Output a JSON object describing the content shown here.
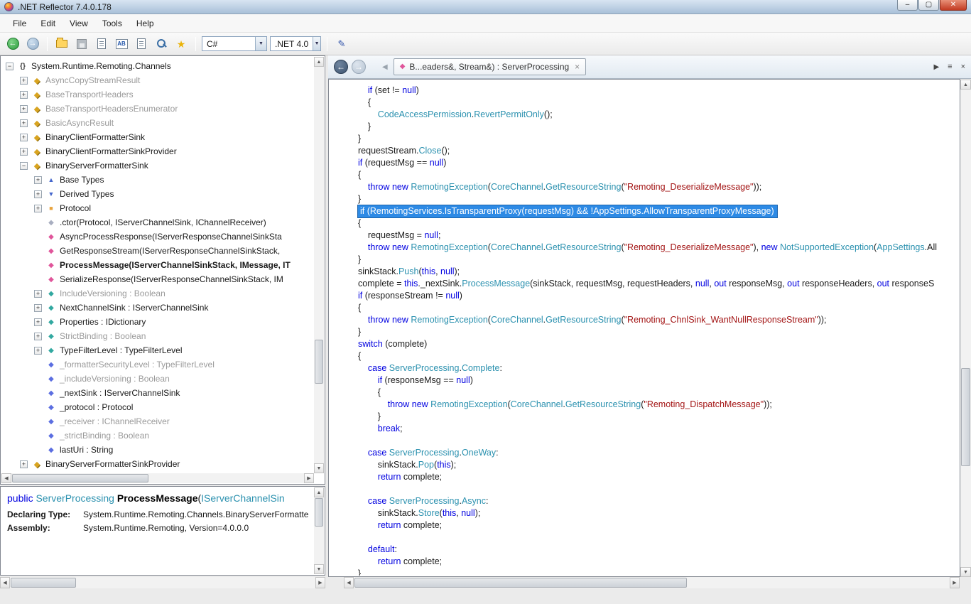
{
  "window": {
    "title": ".NET Reflector 7.4.0.178"
  },
  "menu": {
    "items": [
      "File",
      "Edit",
      "View",
      "Tools",
      "Help"
    ]
  },
  "toolbar": {
    "language_value": "C#",
    "framework_value": ".NET 4.0"
  },
  "docktab": {
    "title": "B...eaders&, Stream&) : ServerProcessing"
  },
  "tree": {
    "rows": [
      {
        "depth": 0,
        "expander": "minus",
        "icon": "namespace",
        "label": "System.Runtime.Remoting.Channels",
        "dim": false
      },
      {
        "depth": 1,
        "expander": "plus",
        "icon": "class",
        "label": "AsyncCopyStreamResult",
        "dim": true
      },
      {
        "depth": 1,
        "expander": "plus",
        "icon": "class",
        "label": "BaseTransportHeaders",
        "dim": true
      },
      {
        "depth": 1,
        "expander": "plus",
        "icon": "class",
        "label": "BaseTransportHeadersEnumerator",
        "dim": true
      },
      {
        "depth": 1,
        "expander": "plus",
        "icon": "class",
        "label": "BasicAsyncResult",
        "dim": true
      },
      {
        "depth": 1,
        "expander": "plus",
        "icon": "class",
        "label": "BinaryClientFormatterSink",
        "dim": false
      },
      {
        "depth": 1,
        "expander": "plus",
        "icon": "class",
        "label": "BinaryClientFormatterSinkProvider",
        "dim": false
      },
      {
        "depth": 1,
        "expander": "minus",
        "icon": "class",
        "label": "BinaryServerFormatterSink",
        "dim": false
      },
      {
        "depth": 2,
        "expander": "plus",
        "icon": "base-types",
        "label": "Base Types",
        "dim": false
      },
      {
        "depth": 2,
        "expander": "plus",
        "icon": "derived-types",
        "label": "Derived Types",
        "dim": false
      },
      {
        "depth": 2,
        "expander": "plus",
        "icon": "enum",
        "label": "Protocol",
        "dim": false
      },
      {
        "depth": 2,
        "expander": "none",
        "icon": "ctor",
        "label": ".ctor(Protocol, IServerChannelSink, IChannelReceiver)",
        "dim": false
      },
      {
        "depth": 2,
        "expander": "none",
        "icon": "method",
        "label": "AsyncProcessResponse(IServerResponseChannelSinkSta",
        "dim": false
      },
      {
        "depth": 2,
        "expander": "none",
        "icon": "method",
        "label": "GetResponseStream(IServerResponseChannelSinkStack,",
        "dim": false
      },
      {
        "depth": 2,
        "expander": "none",
        "icon": "method",
        "label": "ProcessMessage(IServerChannelSinkStack, IMessage, IT",
        "dim": false,
        "bold": true
      },
      {
        "depth": 2,
        "expander": "none",
        "icon": "method",
        "label": "SerializeResponse(IServerResponseChannelSinkStack, IM",
        "dim": false
      },
      {
        "depth": 2,
        "expander": "plus",
        "icon": "property",
        "label": "IncludeVersioning : Boolean",
        "dim": true
      },
      {
        "depth": 2,
        "expander": "plus",
        "icon": "property",
        "label": "NextChannelSink : IServerChannelSink",
        "dim": false
      },
      {
        "depth": 2,
        "expander": "plus",
        "icon": "property",
        "label": "Properties : IDictionary",
        "dim": false
      },
      {
        "depth": 2,
        "expander": "plus",
        "icon": "property",
        "label": "StrictBinding : Boolean",
        "dim": true
      },
      {
        "depth": 2,
        "expander": "plus",
        "icon": "property",
        "label": "TypeFilterLevel : TypeFilterLevel",
        "dim": false
      },
      {
        "depth": 2,
        "expander": "none",
        "icon": "field",
        "label": "_formatterSecurityLevel : TypeFilterLevel",
        "dim": true
      },
      {
        "depth": 2,
        "expander": "none",
        "icon": "field",
        "label": "_includeVersioning : Boolean",
        "dim": true
      },
      {
        "depth": 2,
        "expander": "none",
        "icon": "field",
        "label": "_nextSink : IServerChannelSink",
        "dim": false
      },
      {
        "depth": 2,
        "expander": "none",
        "icon": "field",
        "label": "_protocol : Protocol",
        "dim": false
      },
      {
        "depth": 2,
        "expander": "none",
        "icon": "field",
        "label": "_receiver : IChannelReceiver",
        "dim": true
      },
      {
        "depth": 2,
        "expander": "none",
        "icon": "field",
        "label": "_strictBinding : Boolean",
        "dim": true
      },
      {
        "depth": 2,
        "expander": "none",
        "icon": "field",
        "label": "lastUri : String",
        "dim": false
      },
      {
        "depth": 1,
        "expander": "plus",
        "icon": "class",
        "label": "BinaryServerFormatterSinkProvider",
        "dim": false
      }
    ]
  },
  "code": {
    "lines": [
      {
        "i": 1,
        "tok": [
          [
            "k",
            "if"
          ],
          [
            "p",
            " (set != "
          ],
          [
            "k",
            "null"
          ],
          [
            "p",
            ")"
          ]
        ]
      },
      {
        "i": 1,
        "tok": [
          [
            "p",
            "{"
          ]
        ]
      },
      {
        "i": 2,
        "tok": [
          [
            "t",
            "CodeAccessPermission"
          ],
          [
            "p",
            "."
          ],
          [
            "t",
            "RevertPermitOnly"
          ],
          [
            "p",
            "();"
          ]
        ]
      },
      {
        "i": 1,
        "tok": [
          [
            "p",
            "}"
          ]
        ]
      },
      {
        "i": 0,
        "tok": [
          [
            "p",
            "}"
          ]
        ]
      },
      {
        "i": 0,
        "tok": [
          [
            "p",
            "requestStream."
          ],
          [
            "t",
            "Close"
          ],
          [
            "p",
            "();"
          ]
        ]
      },
      {
        "i": 0,
        "tok": [
          [
            "k",
            "if"
          ],
          [
            "p",
            " (requestMsg == "
          ],
          [
            "k",
            "null"
          ],
          [
            "p",
            ")"
          ]
        ]
      },
      {
        "i": 0,
        "tok": [
          [
            "p",
            "{"
          ]
        ]
      },
      {
        "i": 1,
        "tok": [
          [
            "k",
            "throw"
          ],
          [
            "p",
            " "
          ],
          [
            "k",
            "new"
          ],
          [
            "p",
            " "
          ],
          [
            "t",
            "RemotingException"
          ],
          [
            "p",
            "("
          ],
          [
            "t",
            "CoreChannel"
          ],
          [
            "p",
            "."
          ],
          [
            "t",
            "GetResourceString"
          ],
          [
            "p",
            "("
          ],
          [
            "s",
            "\"Remoting_DeserializeMessage\""
          ],
          [
            "p",
            "));"
          ]
        ]
      },
      {
        "i": 0,
        "tok": [
          [
            "p",
            "}"
          ]
        ]
      },
      {
        "i": 0,
        "sel": true,
        "tok": [
          [
            "w",
            "if (RemotingServices.IsTransparentProxy(requestMsg) && !AppSettings.AllowTransparentProxyMessage)"
          ]
        ]
      },
      {
        "i": 0,
        "tok": [
          [
            "p",
            "{"
          ]
        ]
      },
      {
        "i": 1,
        "tok": [
          [
            "p",
            "requestMsg = "
          ],
          [
            "k",
            "null"
          ],
          [
            "p",
            ";"
          ]
        ]
      },
      {
        "i": 1,
        "tok": [
          [
            "k",
            "throw"
          ],
          [
            "p",
            " "
          ],
          [
            "k",
            "new"
          ],
          [
            "p",
            " "
          ],
          [
            "t",
            "RemotingException"
          ],
          [
            "p",
            "("
          ],
          [
            "t",
            "CoreChannel"
          ],
          [
            "p",
            "."
          ],
          [
            "t",
            "GetResourceString"
          ],
          [
            "p",
            "("
          ],
          [
            "s",
            "\"Remoting_DeserializeMessage\""
          ],
          [
            "p",
            "), "
          ],
          [
            "k",
            "new"
          ],
          [
            "p",
            " "
          ],
          [
            "t",
            "NotSupportedException"
          ],
          [
            "p",
            "("
          ],
          [
            "t",
            "AppSettings"
          ],
          [
            "p",
            ".All"
          ]
        ]
      },
      {
        "i": 0,
        "tok": [
          [
            "p",
            "}"
          ]
        ]
      },
      {
        "i": 0,
        "tok": [
          [
            "p",
            "sinkStack."
          ],
          [
            "t",
            "Push"
          ],
          [
            "p",
            "("
          ],
          [
            "k",
            "this"
          ],
          [
            "p",
            ", "
          ],
          [
            "k",
            "null"
          ],
          [
            "p",
            ");"
          ]
        ]
      },
      {
        "i": 0,
        "tok": [
          [
            "p",
            "complete = "
          ],
          [
            "k",
            "this"
          ],
          [
            "p",
            "._nextSink."
          ],
          [
            "t",
            "ProcessMessage"
          ],
          [
            "p",
            "(sinkStack, requestMsg, requestHeaders, "
          ],
          [
            "k",
            "null"
          ],
          [
            "p",
            ", "
          ],
          [
            "k",
            "out"
          ],
          [
            "p",
            " responseMsg, "
          ],
          [
            "k",
            "out"
          ],
          [
            "p",
            " responseHeaders, "
          ],
          [
            "k",
            "out"
          ],
          [
            "p",
            " responseS"
          ]
        ]
      },
      {
        "i": 0,
        "tok": [
          [
            "k",
            "if"
          ],
          [
            "p",
            " (responseStream != "
          ],
          [
            "k",
            "null"
          ],
          [
            "p",
            ")"
          ]
        ]
      },
      {
        "i": 0,
        "tok": [
          [
            "p",
            "{"
          ]
        ]
      },
      {
        "i": 1,
        "tok": [
          [
            "k",
            "throw"
          ],
          [
            "p",
            " "
          ],
          [
            "k",
            "new"
          ],
          [
            "p",
            " "
          ],
          [
            "t",
            "RemotingException"
          ],
          [
            "p",
            "("
          ],
          [
            "t",
            "CoreChannel"
          ],
          [
            "p",
            "."
          ],
          [
            "t",
            "GetResourceString"
          ],
          [
            "p",
            "("
          ],
          [
            "s",
            "\"Remoting_ChnlSink_WantNullResponseStream\""
          ],
          [
            "p",
            "));"
          ]
        ]
      },
      {
        "i": 0,
        "tok": [
          [
            "p",
            "}"
          ]
        ]
      },
      {
        "i": 0,
        "tok": [
          [
            "k",
            "switch"
          ],
          [
            "p",
            " (complete)"
          ]
        ]
      },
      {
        "i": 0,
        "tok": [
          [
            "p",
            "{"
          ]
        ]
      },
      {
        "i": 1,
        "tok": [
          [
            "k",
            "case"
          ],
          [
            "p",
            " "
          ],
          [
            "t",
            "ServerProcessing"
          ],
          [
            "p",
            "."
          ],
          [
            "t",
            "Complete"
          ],
          [
            "p",
            ":"
          ]
        ]
      },
      {
        "i": 2,
        "tok": [
          [
            "k",
            "if"
          ],
          [
            "p",
            " (responseMsg == "
          ],
          [
            "k",
            "null"
          ],
          [
            "p",
            ")"
          ]
        ]
      },
      {
        "i": 2,
        "tok": [
          [
            "p",
            "{"
          ]
        ]
      },
      {
        "i": 3,
        "tok": [
          [
            "k",
            "throw"
          ],
          [
            "p",
            " "
          ],
          [
            "k",
            "new"
          ],
          [
            "p",
            " "
          ],
          [
            "t",
            "RemotingException"
          ],
          [
            "p",
            "("
          ],
          [
            "t",
            "CoreChannel"
          ],
          [
            "p",
            "."
          ],
          [
            "t",
            "GetResourceString"
          ],
          [
            "p",
            "("
          ],
          [
            "s",
            "\"Remoting_DispatchMessage\""
          ],
          [
            "p",
            "));"
          ]
        ]
      },
      {
        "i": 2,
        "tok": [
          [
            "p",
            "}"
          ]
        ]
      },
      {
        "i": 2,
        "tok": [
          [
            "k",
            "break"
          ],
          [
            "p",
            ";"
          ]
        ]
      },
      {
        "i": 0,
        "tok": []
      },
      {
        "i": 1,
        "tok": [
          [
            "k",
            "case"
          ],
          [
            "p",
            " "
          ],
          [
            "t",
            "ServerProcessing"
          ],
          [
            "p",
            "."
          ],
          [
            "t",
            "OneWay"
          ],
          [
            "p",
            ":"
          ]
        ]
      },
      {
        "i": 2,
        "tok": [
          [
            "p",
            "sinkStack."
          ],
          [
            "t",
            "Pop"
          ],
          [
            "p",
            "("
          ],
          [
            "k",
            "this"
          ],
          [
            "p",
            ");"
          ]
        ]
      },
      {
        "i": 2,
        "tok": [
          [
            "k",
            "return"
          ],
          [
            "p",
            " complete;"
          ]
        ]
      },
      {
        "i": 0,
        "tok": []
      },
      {
        "i": 1,
        "tok": [
          [
            "k",
            "case"
          ],
          [
            "p",
            " "
          ],
          [
            "t",
            "ServerProcessing"
          ],
          [
            "p",
            "."
          ],
          [
            "t",
            "Async"
          ],
          [
            "p",
            ":"
          ]
        ]
      },
      {
        "i": 2,
        "tok": [
          [
            "p",
            "sinkStack."
          ],
          [
            "t",
            "Store"
          ],
          [
            "p",
            "("
          ],
          [
            "k",
            "this"
          ],
          [
            "p",
            ", "
          ],
          [
            "k",
            "null"
          ],
          [
            "p",
            ");"
          ]
        ]
      },
      {
        "i": 2,
        "tok": [
          [
            "k",
            "return"
          ],
          [
            "p",
            " complete;"
          ]
        ]
      },
      {
        "i": 0,
        "tok": []
      },
      {
        "i": 1,
        "tok": [
          [
            "k",
            "default"
          ],
          [
            "p",
            ":"
          ]
        ]
      },
      {
        "i": 2,
        "tok": [
          [
            "k",
            "return"
          ],
          [
            "p",
            " complete;"
          ]
        ]
      },
      {
        "i": 0,
        "tok": [
          [
            "p",
            "}"
          ]
        ]
      }
    ]
  },
  "info": {
    "signature": [
      [
        "k",
        "public "
      ],
      [
        "t",
        "ServerProcessing "
      ],
      [
        "b",
        "ProcessMessage"
      ],
      [
        "p",
        "("
      ],
      [
        "t",
        "IServerChannelSin"
      ]
    ],
    "declaring_type_label": "Declaring Type:",
    "declaring_type": "System.Runtime.Remoting.Channels.BinaryServerFormatte",
    "assembly_label": "Assembly:",
    "assembly": "System.Runtime.Remoting, Version=4.0.0.0"
  }
}
